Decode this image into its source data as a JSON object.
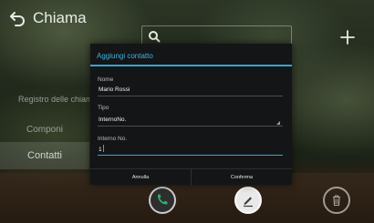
{
  "header": {
    "title": "Chiama",
    "back_icon": "back-arrow-icon",
    "search_icon": "search-icon",
    "add_icon": "plus-icon"
  },
  "sidebar": {
    "items": [
      {
        "label": "Registro delle chiam"
      },
      {
        "label": "Componi"
      },
      {
        "label": "Contatti"
      }
    ]
  },
  "bottom_bar": {
    "icons": [
      "phone-icon",
      "edit-icon",
      "trash-icon"
    ]
  },
  "dialog": {
    "title": "Aggiungi contatto",
    "fields": {
      "name": {
        "label": "Nome",
        "value": "Mario Rossi"
      },
      "type": {
        "label": "Tipo",
        "value": "InternoNo."
      },
      "extension": {
        "label": "Interno No.",
        "value": "1"
      }
    },
    "cancel_label": "Annulla",
    "confirm_label": "Conferma"
  },
  "colors": {
    "accent": "#33a6d8",
    "dialog_bg": "#141516"
  }
}
